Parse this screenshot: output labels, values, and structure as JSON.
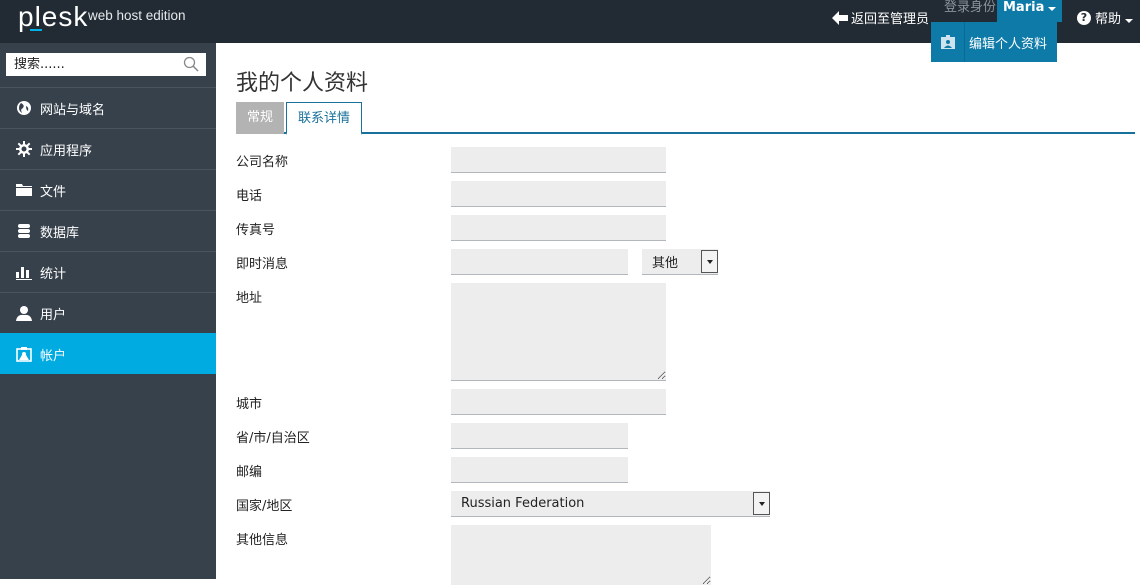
{
  "header": {
    "logo": "plesk",
    "edition": "web host edition",
    "back_to_admin": "返回至管理员",
    "login_as_label": "登录身份",
    "user_name": "Maria",
    "help_label": "帮助",
    "user_menu": {
      "items": [
        {
          "label": "编辑个人资料",
          "icon": "profile-card-icon"
        }
      ]
    }
  },
  "sidebar": {
    "search": {
      "placeholder": "搜索......",
      "value": ""
    },
    "items": [
      {
        "label": "网站与域名",
        "icon": "globe-icon",
        "active": false
      },
      {
        "label": "应用程序",
        "icon": "gear-icon",
        "active": false
      },
      {
        "label": "文件",
        "icon": "folder-icon",
        "active": false
      },
      {
        "label": "数据库",
        "icon": "database-icon",
        "active": false
      },
      {
        "label": "统计",
        "icon": "bar-chart-icon",
        "active": false
      },
      {
        "label": "用户",
        "icon": "user-icon",
        "active": false
      },
      {
        "label": "帐户",
        "icon": "account-card-icon",
        "active": true
      }
    ]
  },
  "main": {
    "title": "我的个人资料",
    "tabs": [
      {
        "label": "常规",
        "active": false
      },
      {
        "label": "联系详情",
        "active": true
      }
    ],
    "form": {
      "company": {
        "label": "公司名称",
        "value": ""
      },
      "phone": {
        "label": "电话",
        "value": ""
      },
      "fax": {
        "label": "传真号",
        "value": ""
      },
      "im": {
        "label": "即时消息",
        "value": "",
        "type_selected": "其他"
      },
      "address": {
        "label": "地址",
        "value": ""
      },
      "city": {
        "label": "城市",
        "value": ""
      },
      "state": {
        "label": "省/市/自治区",
        "value": ""
      },
      "zip": {
        "label": "邮编",
        "value": ""
      },
      "country": {
        "label": "国家/地区",
        "selected": "Russian Federation"
      },
      "other": {
        "label": "其他信息",
        "value": ""
      }
    }
  },
  "colors": {
    "topbar": "#222a33",
    "sidebar": "#37414b",
    "active_nav": "#00abe1",
    "user_menu": "#0e7aa8",
    "tab_accent": "#18719c",
    "input_bg": "#ededed"
  }
}
